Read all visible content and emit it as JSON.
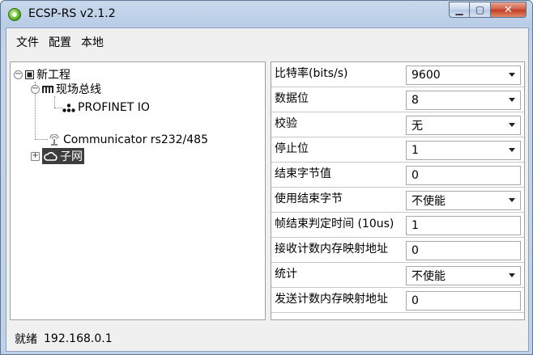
{
  "window": {
    "title": "ECSP-RS v2.1.2"
  },
  "menu": {
    "items": [
      "文件",
      "配置",
      "本地"
    ]
  },
  "tree": {
    "root": "新工程",
    "fieldbus": "现场总线",
    "profinet": "PROFINET IO",
    "communicator": "Communicator rs232/485",
    "subnet": "子网"
  },
  "properties": [
    {
      "label": "比特率(bits/s)",
      "value": "9600",
      "type": "combo"
    },
    {
      "label": "数据位",
      "value": "8",
      "type": "combo"
    },
    {
      "label": "校验",
      "value": "无",
      "type": "combo"
    },
    {
      "label": "停止位",
      "value": "1",
      "type": "combo"
    },
    {
      "label": "结束字节值",
      "value": "0",
      "type": "text"
    },
    {
      "label": "使用结束字节",
      "value": "不使能",
      "type": "combo"
    },
    {
      "label": "帧结束判定时间 (10us)",
      "value": "1",
      "type": "text"
    },
    {
      "label": "接收计数内存映射地址",
      "value": "0",
      "type": "text"
    },
    {
      "label": "统计",
      "value": "不使能",
      "type": "combo"
    },
    {
      "label": "发送计数内存映射地址",
      "value": "0",
      "type": "text"
    }
  ],
  "status": {
    "state": "就绪",
    "ip": "192.168.0.1"
  }
}
